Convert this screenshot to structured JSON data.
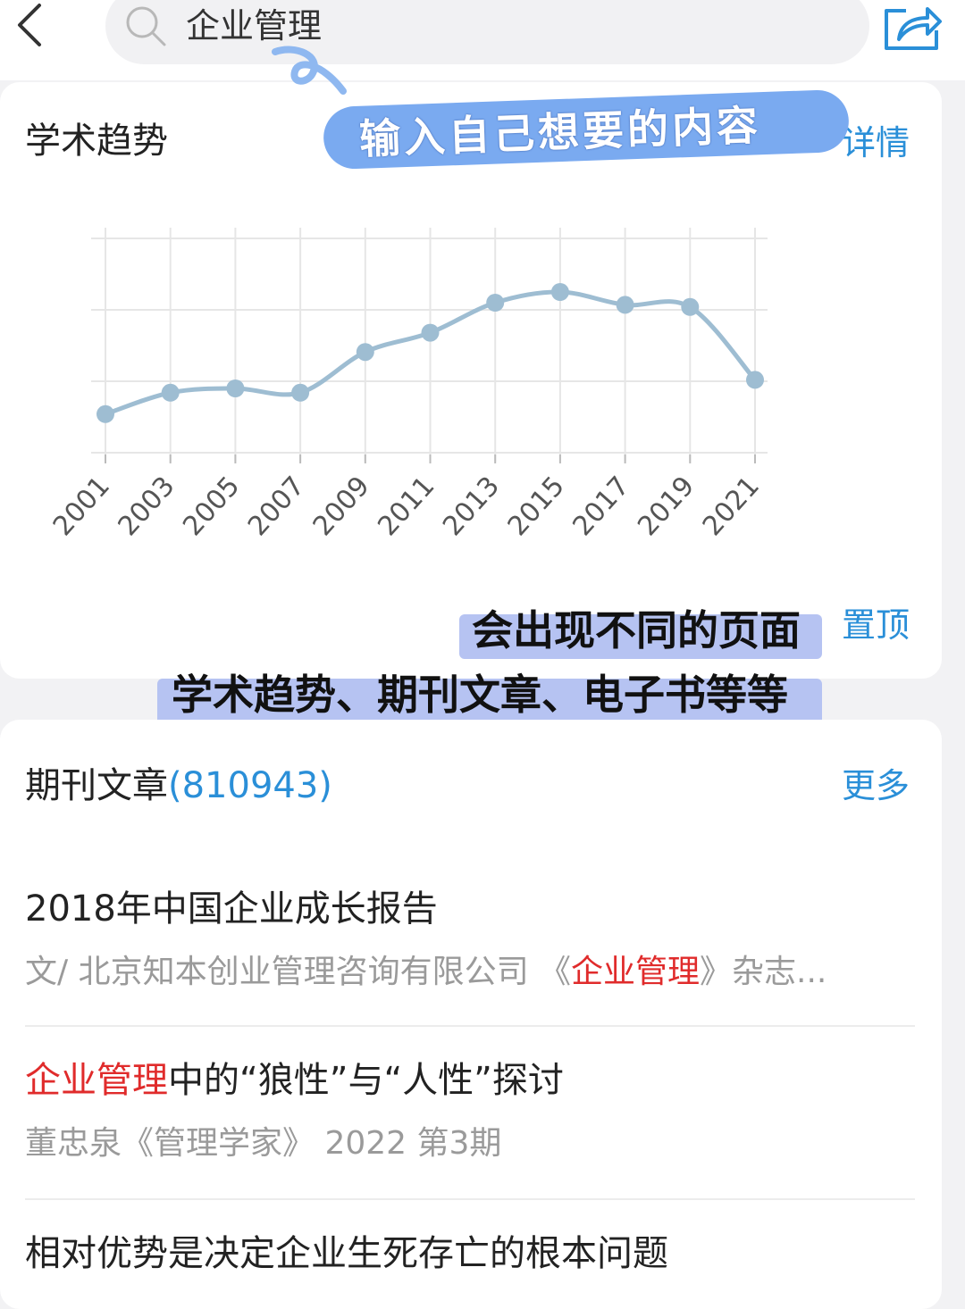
{
  "search": {
    "query": "企业管理"
  },
  "annotations": {
    "search_tip": "输入自己想要的内容",
    "page_tip_line1": "会出现不同的页面",
    "page_tip_line2": "学术趋势、期刊文章、电子书等等"
  },
  "trend": {
    "title": "学术趋势",
    "details_link": "详情",
    "pin_link": "置顶"
  },
  "chart_data": {
    "type": "line",
    "x": [
      "2001",
      "2003",
      "2005",
      "2007",
      "2009",
      "2011",
      "2013",
      "2015",
      "2017",
      "2019",
      "2021"
    ],
    "series": [
      {
        "values": [
          18,
          28,
          30,
          28,
          47,
          56,
          70,
          75,
          69,
          68,
          34
        ]
      }
    ],
    "ylim": [
      0,
      100
    ],
    "grid": true,
    "line_color": "#9ebdd2"
  },
  "journal": {
    "title": "期刊文章",
    "count": "(810943)",
    "more_link": "更多",
    "articles": [
      {
        "title": "2018年中国企业成长报告",
        "meta_prefix": "文/ 北京知本创业管理咨询有限公司 《",
        "meta_highlight": "企业管理",
        "meta_suffix": "》杂志..."
      },
      {
        "title_highlight": "企业管理",
        "title_rest": "中的“狼性”与“人性”探讨",
        "meta": "董忠泉《管理学家》 2022 第3期"
      },
      {
        "title": "相对优势是决定企业生死存亡的根本问题"
      }
    ]
  }
}
